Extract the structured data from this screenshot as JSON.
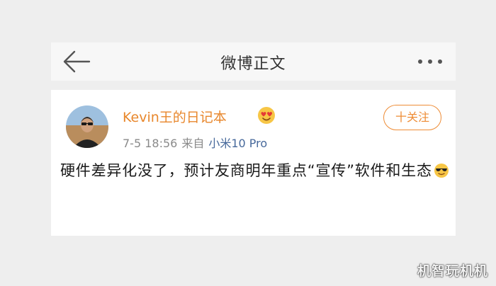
{
  "header": {
    "back_icon": "arrow-left-icon",
    "title": "微博正文",
    "more_icon": "more-dots-icon"
  },
  "post": {
    "author": {
      "avatar_icon": "user-avatar",
      "name": "Kevin王的日记本",
      "badge_icon": "vip-heart-eyes-icon"
    },
    "time": "7-5 18:56",
    "from_label": "来自",
    "device": "小米10 Pro",
    "follow_label": "十关注",
    "text": "硬件差异化没了，预计友商明年重点“宣传”软件和生态",
    "emoji_icon": "cool-sunglasses-emoji"
  },
  "watermark": "机智玩机机",
  "colors": {
    "accent_orange": "#ee8c36",
    "link_blue": "#47699b",
    "page_bg": "#eeeeee",
    "card_bg": "#ffffff"
  }
}
